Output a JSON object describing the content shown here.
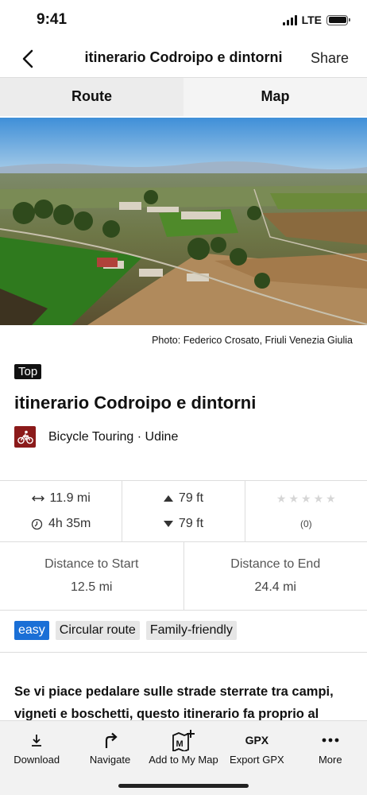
{
  "status_bar": {
    "time": "9:41",
    "network": "LTE"
  },
  "nav": {
    "title": "itinerario Codroipo e dintorni",
    "share_label": "Share"
  },
  "tabs": [
    {
      "label": "Route",
      "active": true
    },
    {
      "label": "Map",
      "active": false
    }
  ],
  "photo": {
    "credit": "Photo: Federico Crosato, Friuli Venezia Giulia"
  },
  "route": {
    "badge": "Top",
    "title": "itinerario Codroipo e dintorni",
    "activity": "Bicycle Touring · Udine",
    "activity_color": "#8b1a1a"
  },
  "stats": {
    "distance": "11.9 mi",
    "duration": "4h 35m",
    "ascent": "79 ft",
    "descent": "79 ft",
    "rating_stars": 0,
    "rating_count": "(0)"
  },
  "distances": {
    "start_label": "Distance to Start",
    "start_value": "12.5 mi",
    "end_label": "Distance to End",
    "end_value": "24.4 mi"
  },
  "tags": [
    {
      "label": "easy",
      "color": "#1a6fd6"
    },
    {
      "label": "Circular route"
    },
    {
      "label": "Family-friendly"
    }
  ],
  "description": "Se vi piace pedalare sulle strade sterrate tra campi, vigneti e boschetti, questo itinerario fa proprio al",
  "toolbar": [
    {
      "label": "Download",
      "icon": "download-icon"
    },
    {
      "label": "Navigate",
      "icon": "navigate-icon"
    },
    {
      "label": "Add to My Map",
      "icon": "add-map-icon"
    },
    {
      "label": "Export GPX",
      "icon": "gpx-icon",
      "icon_text": "GPX"
    },
    {
      "label": "More",
      "icon": "more-icon"
    }
  ]
}
